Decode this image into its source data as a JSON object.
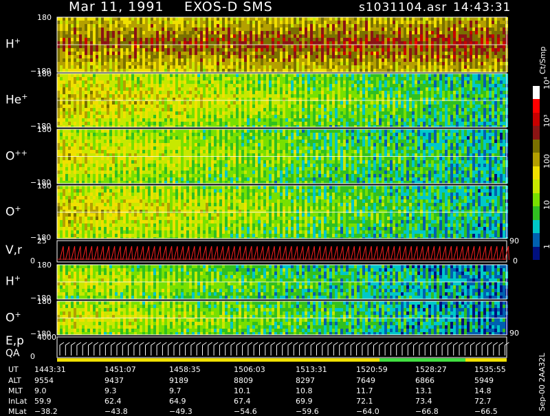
{
  "header": {
    "date": "Mar 11, 1991",
    "instrument": "EXOS-D SMS",
    "file": "s1031104.asr",
    "time": "14:43:31"
  },
  "colorbar": {
    "unit": "Ct/Smp",
    "ticks": [
      "10⁴",
      "10³",
      "100",
      "10",
      "1"
    ],
    "colors": [
      "#ffffff",
      "#ff0000",
      "#c80000",
      "#8a1414",
      "#7a7000",
      "#b4a000",
      "#f0e000",
      "#c8e800",
      "#78e000",
      "#30c020",
      "#00c8c8",
      "#0060b0",
      "#001080"
    ]
  },
  "chart_data": {
    "type": "heatmap",
    "panels": [
      {
        "id": "h-plus-top",
        "label": "H",
        "sup": "+",
        "ymax": "180",
        "ymin": "−180",
        "level_start": 0.62,
        "level_end": 0.7
      },
      {
        "id": "he-plus",
        "label": "He",
        "sup": "+",
        "ymax": "180",
        "ymin": "−180",
        "level_start": 0.52,
        "level_end": 0.15
      },
      {
        "id": "o-plusplus",
        "label": "O",
        "sup": "++",
        "ymax": "180",
        "ymin": "−180",
        "level_start": 0.45,
        "level_end": 0.12
      },
      {
        "id": "o-plus-top",
        "label": "O",
        "sup": "+",
        "ymax": "180",
        "ymin": "−180",
        "level_start": 0.5,
        "level_end": 0.12
      },
      {
        "id": "vr",
        "label": "V",
        "sup": "",
        "label_suffix": ",r",
        "ymax": "25",
        "ymin": "0",
        "right_max": "90",
        "right_min": "0"
      },
      {
        "id": "h-plus-bottom",
        "label": "H",
        "sup": "+",
        "ymax": "180",
        "ymin": "−180",
        "level_start": 0.4,
        "level_end": 0.05
      },
      {
        "id": "o-plus-bottom",
        "label": "O",
        "sup": "+",
        "ymax": "180",
        "ymin": "−180",
        "level_start": 0.45,
        "level_end": 0.05
      },
      {
        "id": "ep",
        "label": "E,p",
        "sup": "",
        "label2": "QA",
        "ymax": "4000",
        "ymin": "0",
        "right_max": "90"
      }
    ],
    "x_labels": {
      "row_names": [
        "UT",
        "ALT",
        "MLT",
        "InLat",
        "MLat"
      ],
      "columns": [
        {
          "UT": "1443:31",
          "ALT": "9554",
          "MLT": "9.0",
          "InLat": "59.9",
          "MLat": "−38.2"
        },
        {
          "UT": "1451:07",
          "ALT": "9437",
          "MLT": "9.3",
          "InLat": "62.4",
          "MLat": "−43.8"
        },
        {
          "UT": "1458:35",
          "ALT": "9189",
          "MLT": "9.7",
          "InLat": "64.9",
          "MLat": "−49.3"
        },
        {
          "UT": "1506:03",
          "ALT": "8809",
          "MLT": "10.1",
          "InLat": "67.4",
          "MLat": "−54.6"
        },
        {
          "UT": "1513:31",
          "ALT": "8297",
          "MLT": "10.8",
          "InLat": "69.9",
          "MLat": "−59.6"
        },
        {
          "UT": "1520:59",
          "ALT": "7649",
          "MLT": "11.7",
          "InLat": "72.1",
          "MLat": "−64.0"
        },
        {
          "UT": "1528:27",
          "ALT": "6866",
          "MLT": "13.1",
          "InLat": "73.4",
          "MLat": "−66.8"
        },
        {
          "UT": "1535:55",
          "ALT": "5949",
          "MLT": "14.8",
          "InLat": "72.7",
          "MLat": "−66.5"
        }
      ]
    }
  },
  "footer": {
    "side_note": "Sep-00  2AA32L"
  }
}
